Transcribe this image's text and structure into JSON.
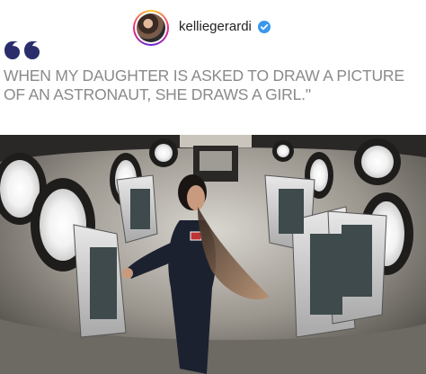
{
  "post": {
    "username": "kelliegerardi",
    "verified": true,
    "quote_text": "WHEN MY DAUGHTER IS ASKED TO DRAW A PICTURE OF AN ASTRONAUT, SHE DRAWS A GIRL.\"",
    "quote_mark_color": "#2b2d6b",
    "quote_text_color": "#8a8a8a"
  },
  "icons": {
    "verified": "verified-badge-icon",
    "quote": "quote-mark-icon"
  },
  "photo": {
    "subject": "astronaut-floating-in-spacecraft-cabin"
  }
}
